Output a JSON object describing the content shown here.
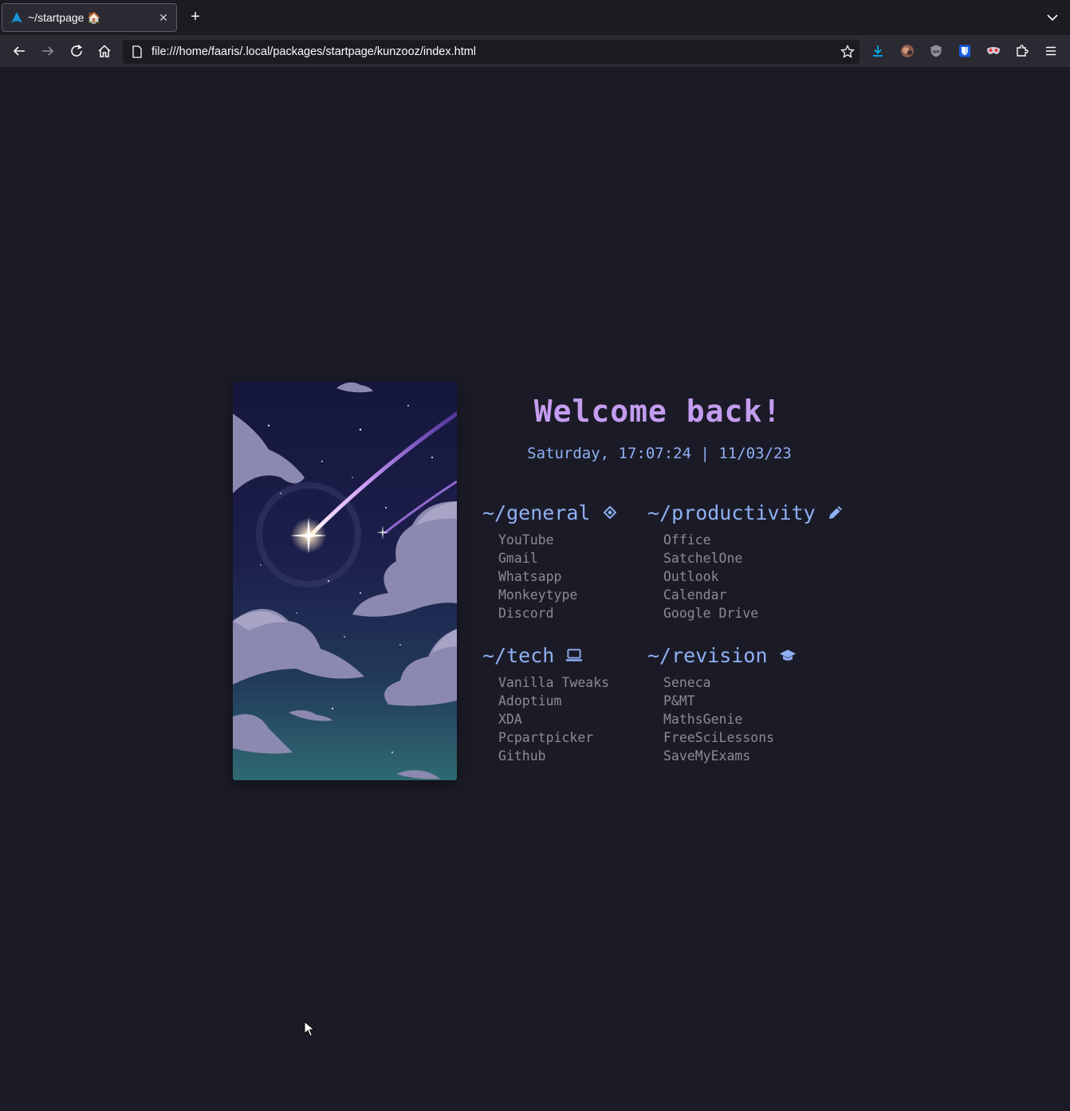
{
  "browser": {
    "tab": {
      "title": "~/startpage 🏠",
      "favicon": "arch-logo-icon"
    },
    "new_tab": "+",
    "url": "file:///home/faaris/.local/packages/startpage/kunzooz/index.html",
    "accent": "#00b3f4"
  },
  "page": {
    "greeting": "Welcome back!",
    "datetime": "Saturday, 17:07:24 | 11/03/23",
    "colors": {
      "background": "#1b1b27",
      "greeting": "#c49cf0",
      "heading": "#8fb0f4",
      "link": "#8b8b98"
    },
    "sections": [
      {
        "title": "~/general",
        "icon": "diamond-icon",
        "links": [
          "YouTube",
          "Gmail",
          "Whatsapp",
          "Monkeytype",
          "Discord"
        ]
      },
      {
        "title": "~/productivity",
        "icon": "pencil-icon",
        "links": [
          "Office",
          "SatchelOne",
          "Outlook",
          "Calendar",
          "Google Drive"
        ]
      },
      {
        "title": "~/tech",
        "icon": "laptop-icon",
        "links": [
          "Vanilla Tweaks",
          "Adoptium",
          "XDA",
          "Pcpartpicker",
          "Github"
        ]
      },
      {
        "title": "~/revision",
        "icon": "graduation-cap-icon",
        "links": [
          "Seneca",
          "P&MT",
          "MathsGenie",
          "FreeSciLessons",
          "SaveMyExams"
        ]
      }
    ]
  }
}
